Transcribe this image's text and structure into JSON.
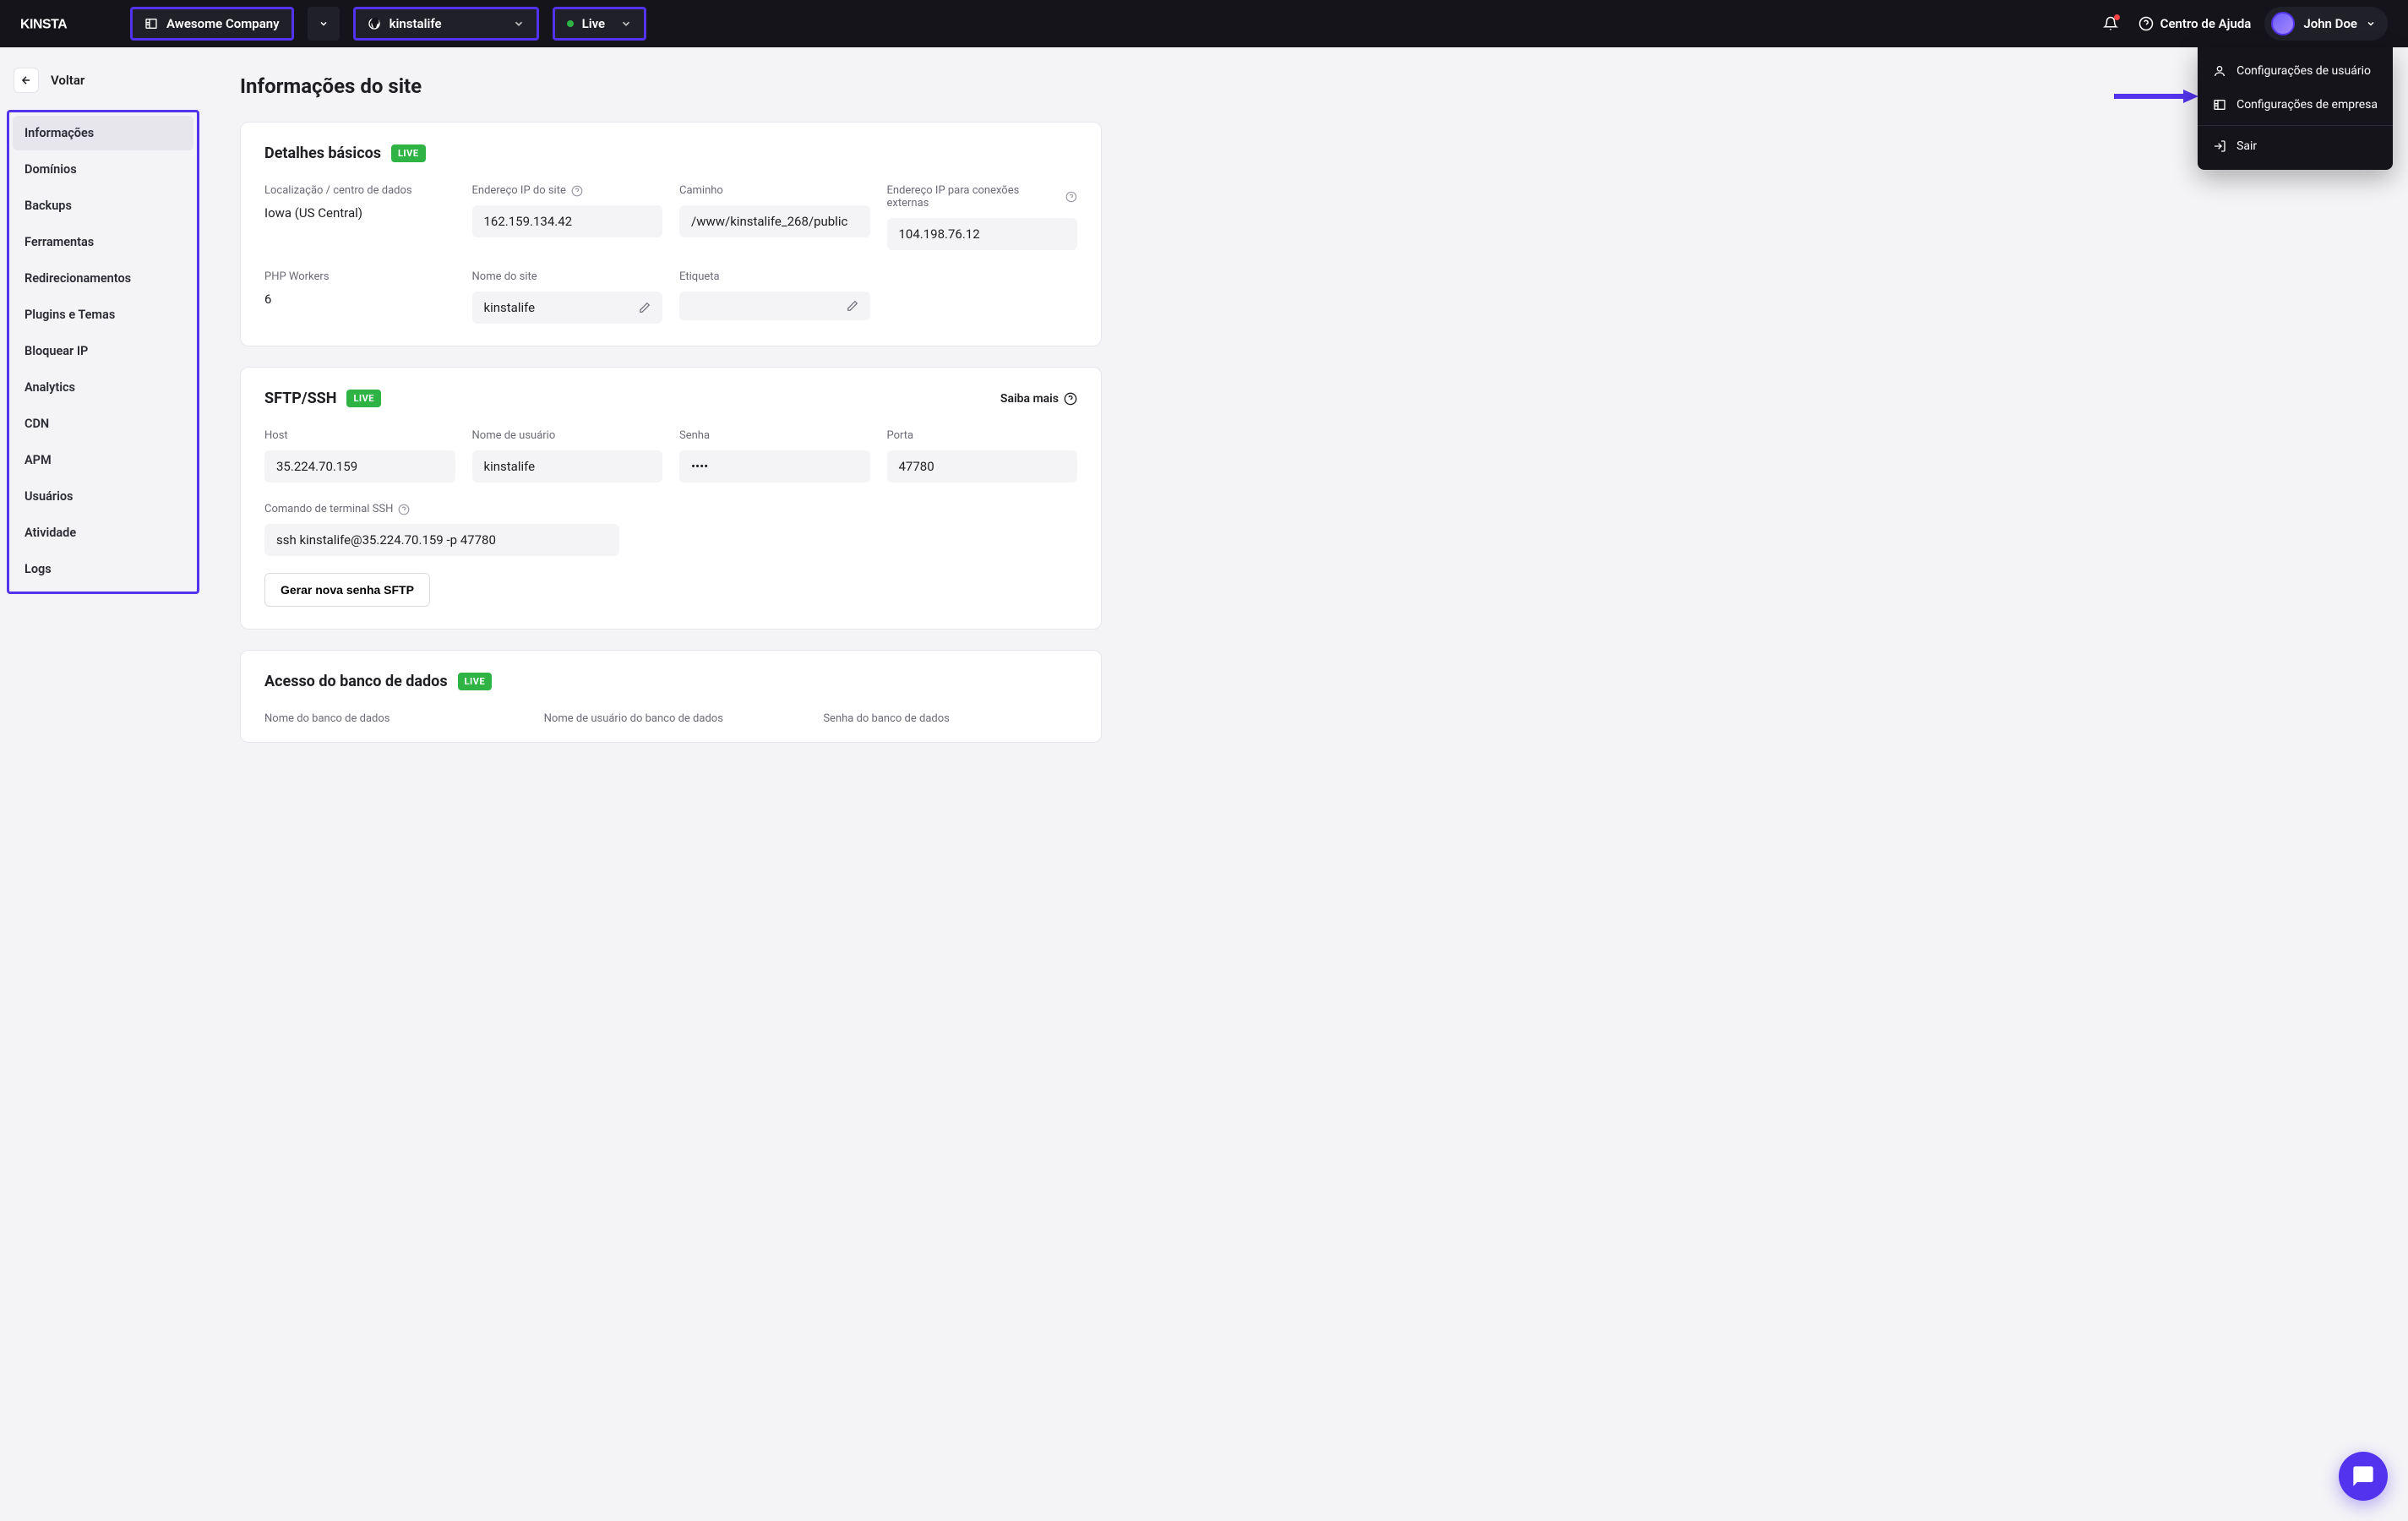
{
  "header": {
    "company": "Awesome Company",
    "site": "kinstalife",
    "env": "Live",
    "help": "Centro de Ajuda",
    "user": "John Doe"
  },
  "user_menu": {
    "user_settings": "Configurações de usuário",
    "company_settings": "Configurações de empresa",
    "logout": "Sair"
  },
  "sidebar": {
    "back": "Voltar",
    "items": [
      "Informações",
      "Domínios",
      "Backups",
      "Ferramentas",
      "Redirecionamentos",
      "Plugins e Temas",
      "Bloquear IP",
      "Analytics",
      "CDN",
      "APM",
      "Usuários",
      "Atividade",
      "Logs"
    ]
  },
  "page": {
    "title": "Informações do site"
  },
  "basic": {
    "title": "Detalhes básicos",
    "badge": "LIVE",
    "location_label": "Localização / centro de dados",
    "location_value": "Iowa (US Central)",
    "ip_label": "Endereço IP do site",
    "ip_value": "162.159.134.42",
    "path_label": "Caminho",
    "path_value": "/www/kinstalife_268/public",
    "ext_ip_label": "Endereço IP para conexões externas",
    "ext_ip_value": "104.198.76.12",
    "workers_label": "PHP Workers",
    "workers_value": "6",
    "sitename_label": "Nome do site",
    "sitename_value": "kinstalife",
    "tag_label": "Etiqueta",
    "tag_value": ""
  },
  "sftp": {
    "title": "SFTP/SSH",
    "badge": "LIVE",
    "learn_more": "Saiba mais",
    "host_label": "Host",
    "host_value": "35.224.70.159",
    "user_label": "Nome de usuário",
    "user_value": "kinstalife",
    "pass_label": "Senha",
    "pass_value": "••••",
    "port_label": "Porta",
    "port_value": "47780",
    "ssh_cmd_label": "Comando de terminal SSH",
    "ssh_cmd_value": "ssh kinstalife@35.224.70.159 -p 47780",
    "gen_button": "Gerar nova senha SFTP"
  },
  "db": {
    "title": "Acesso do banco de dados",
    "badge": "LIVE",
    "name_label": "Nome do banco de dados",
    "user_label": "Nome de usuário do banco de dados",
    "pass_label": "Senha do banco de dados"
  }
}
